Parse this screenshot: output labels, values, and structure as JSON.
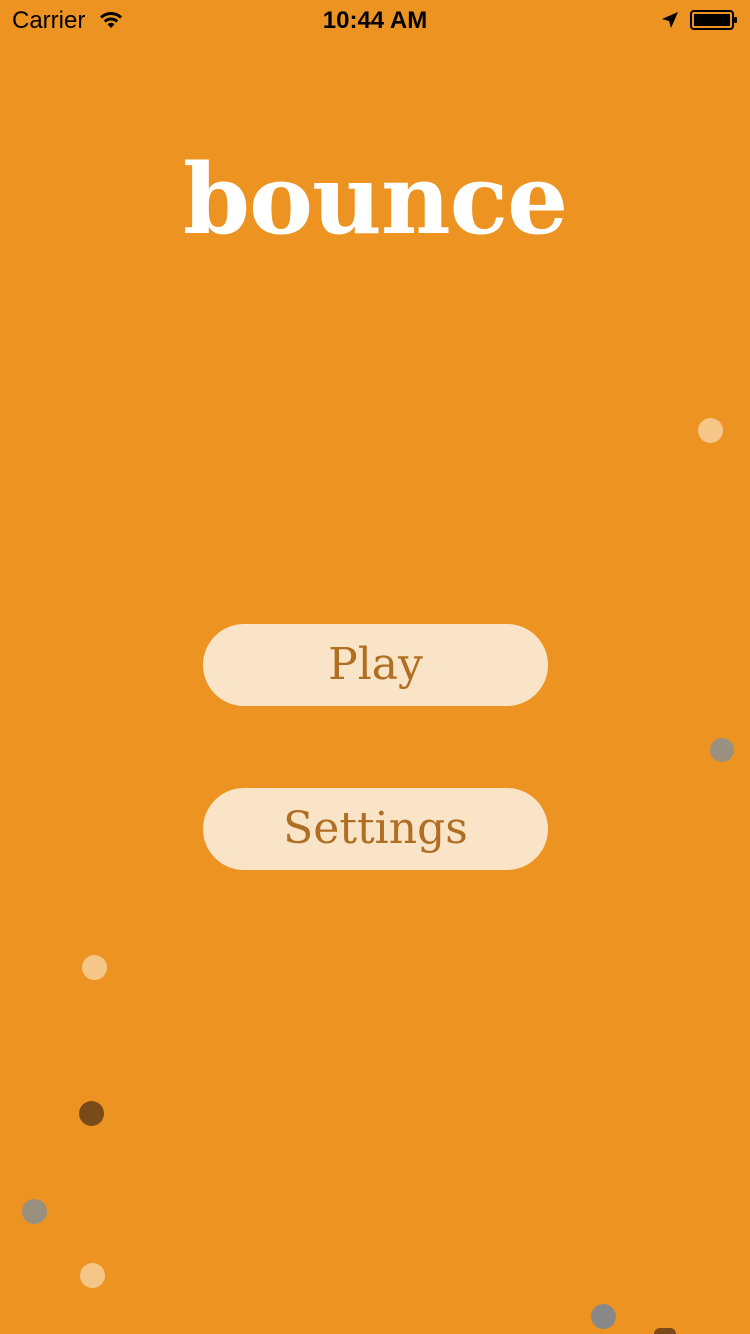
{
  "status_bar": {
    "carrier": "Carrier",
    "time": "10:44 AM",
    "icons": [
      "wifi-icon",
      "location-arrow-icon",
      "battery-icon"
    ]
  },
  "game": {
    "title": "bounce",
    "background_color": "#ED9321"
  },
  "menu": {
    "play_label": "Play",
    "settings_label": "Settings",
    "button_color": "#FAE4C8",
    "button_text_color": "#B06E22"
  },
  "balls": {
    "colors": [
      "#F6C689",
      "#999080",
      "#7A4A18",
      "#888888"
    ]
  }
}
